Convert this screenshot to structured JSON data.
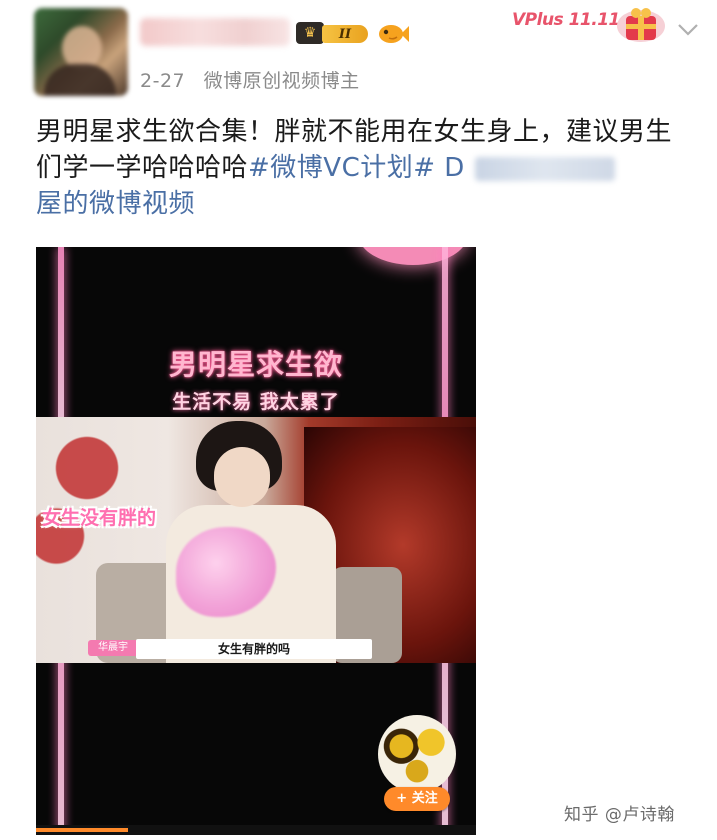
{
  "header": {
    "username": "",
    "level_badge": "II",
    "date": "2-27",
    "author_tag": "微博原创视频博主",
    "vplus_label": "VPlus 11.11"
  },
  "post": {
    "text_main": "男明星求生欲合集！胖就不能用在女生身上，建议男生们学一学哈哈哈哈",
    "hashtag": "#微博VC计划#",
    "link_prefix": "D",
    "link_suffix": "屋的微博视频"
  },
  "video": {
    "title": "男明星求生欲",
    "subtitle": "生活不易 我太累了",
    "pink_caption": "女生没有胖的",
    "name_tag": "华晨宇",
    "caption": "女生有胖的吗",
    "follow_label": "+ 关注",
    "progress": 0.21
  },
  "watermark": {
    "text": "知乎 @卢诗翰"
  },
  "icons": [
    "crown-icon",
    "fish-icon",
    "gift-icon",
    "chevron-down-icon",
    "sunflower-avatar"
  ],
  "colors": {
    "hashtag": "#4a6fa5",
    "follow": "#ff8a2a",
    "video_title": "#ffb7cf",
    "vplus": "#e8546b"
  }
}
